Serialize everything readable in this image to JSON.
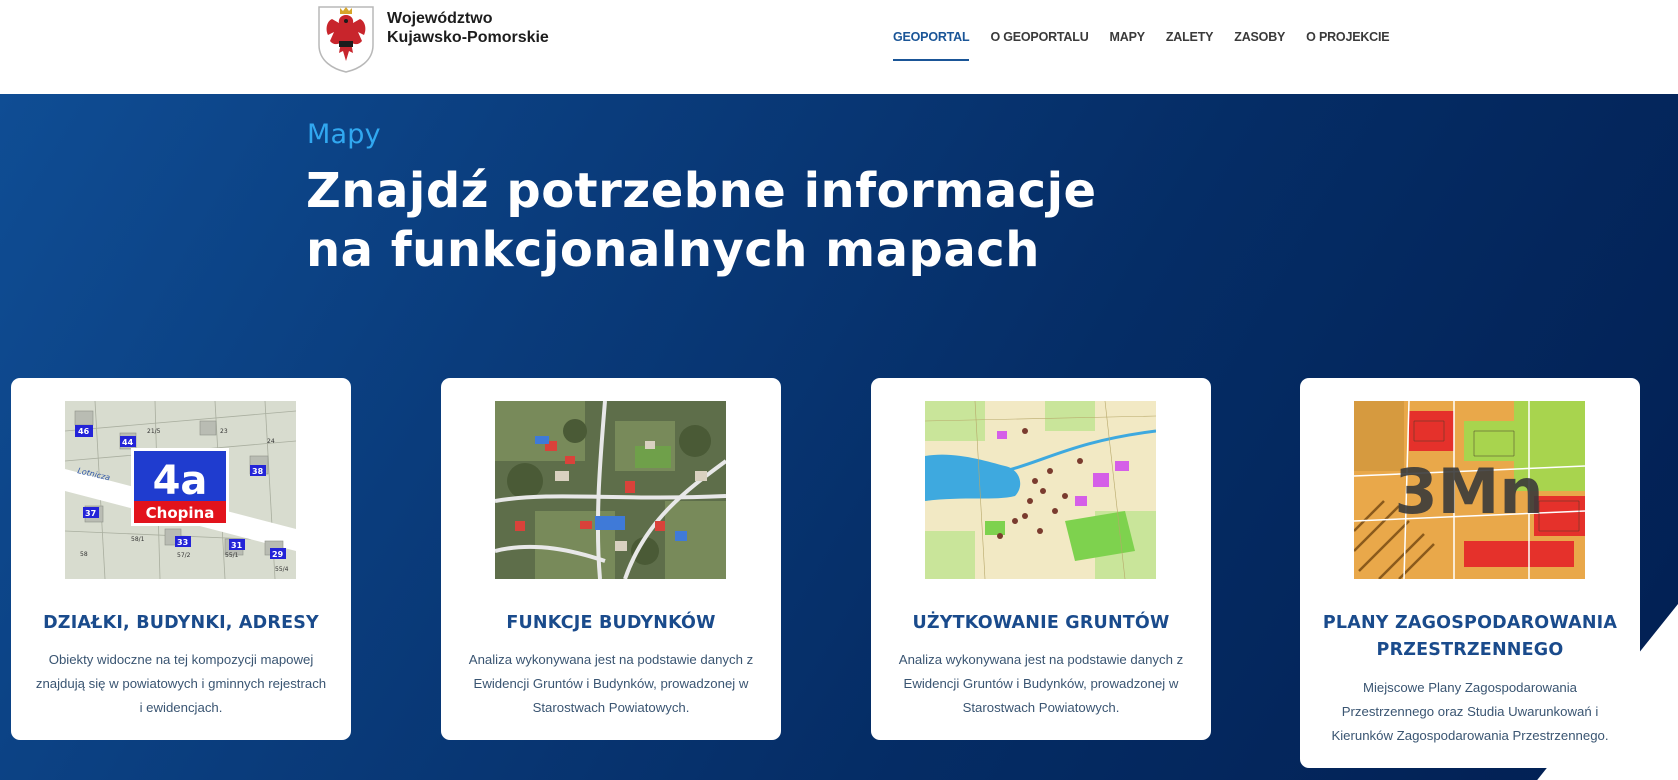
{
  "logo": {
    "line1": "Województwo",
    "line2": "Kujawsko-Pomorskie"
  },
  "nav": [
    {
      "label": "GEOPORTAL",
      "active": true
    },
    {
      "label": "O GEOPORTALU"
    },
    {
      "label": "MAPY"
    },
    {
      "label": "ZALETY"
    },
    {
      "label": "ZASOBY"
    },
    {
      "label": "O PROJEKCIE"
    }
  ],
  "hero": {
    "eyebrow": "Mapy",
    "headline_line1": "Znajdź potrzebne informacje",
    "headline_line2": "na funkcjonalnych mapach"
  },
  "cards": [
    {
      "title": "DZIAŁKI, BUDYNKI, ADRESY",
      "text": "Obiekty widoczne na tej kompozycji mapowej znajdują się w powiatowych i gminnych rejestrach i ewidencjach.",
      "image_labels": {
        "number": "4a",
        "street": "Chopina",
        "road": "Lotnicza",
        "tags": [
          "46",
          "44",
          "38",
          "37",
          "33",
          "31",
          "29"
        ],
        "parcels": [
          "21/5",
          "23",
          "24",
          "58/1",
          "57/2",
          "55/1",
          "55/4",
          "58"
        ]
      }
    },
    {
      "title": "FUNKCJE BUDYNKÓW",
      "text": "Analiza wykonywana jest na podstawie danych z Ewidencji Gruntów i Budynków, prowadzonej w Starostwach Powiatowych."
    },
    {
      "title": "UŻYTKOWANIE GRUNTÓW",
      "text": "Analiza wykonywana jest na podstawie danych z Ewidencji Gruntów i Budynków, prowadzonej w Starostwach Powiatowych."
    },
    {
      "title": "PLANY ZAGOSPODAROWANIA PRZESTRZENNEGO",
      "text": "Miejscowe Plany Zagospodarowania Przestrzennego oraz Studia Uwarunkowań i Kierunków Zagospodarowania Przestrzennego.",
      "image_labels": {
        "code": "3Mn"
      }
    }
  ],
  "colors": {
    "accent": "#1a5597",
    "hero_dark": "#021f52",
    "eyebrow": "#31a8f0",
    "card_title": "#1a4b8c"
  }
}
